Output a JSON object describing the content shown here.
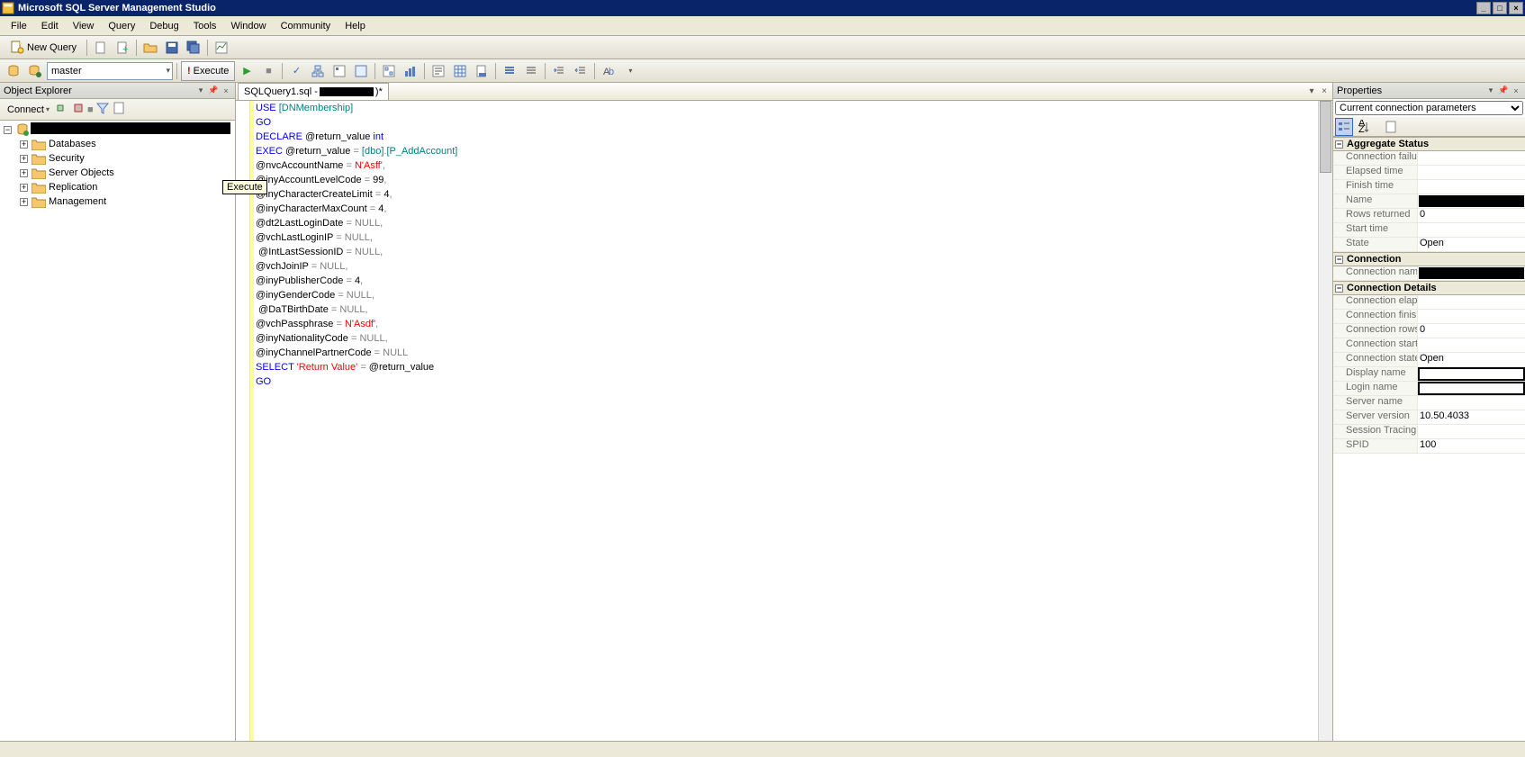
{
  "title": "Microsoft SQL Server Management Studio",
  "menu": [
    "File",
    "Edit",
    "View",
    "Query",
    "Debug",
    "Tools",
    "Window",
    "Community",
    "Help"
  ],
  "toolbar1": {
    "newquery": "New Query"
  },
  "toolbar2": {
    "database_combo": "master",
    "execute": "Execute",
    "tooltip": "Execute"
  },
  "object_explorer": {
    "title": "Object Explorer",
    "connect": "Connect",
    "nodes": [
      "Databases",
      "Security",
      "Server Objects",
      "Replication",
      "Management"
    ]
  },
  "editor": {
    "tab_prefix": "SQLQuery1.sql - ",
    "tab_suffix": ")*",
    "code_tokens": [
      [
        [
          "kw",
          "USE"
        ],
        [
          "var",
          " "
        ],
        [
          "sys",
          "[DNMembership]"
        ]
      ],
      [
        [
          "kw",
          "GO"
        ]
      ],
      [
        [
          "kw",
          "DECLARE"
        ],
        [
          "var",
          " @return_value "
        ],
        [
          "kw",
          "int"
        ]
      ],
      [
        [
          "kw",
          "EXEC"
        ],
        [
          "var",
          " @return_value "
        ],
        [
          "op",
          "="
        ],
        [
          "var",
          " "
        ],
        [
          "sys",
          "[dbo]"
        ],
        [
          "op",
          "."
        ],
        [
          "sys",
          "[P_AddAccount]"
        ]
      ],
      [
        [
          "var",
          "@nvcAccountName "
        ],
        [
          "op",
          "="
        ],
        [
          "var",
          " "
        ],
        [
          "str",
          "N'Asff'"
        ],
        [
          "op",
          ","
        ]
      ],
      [
        [
          "var",
          "@inyAccountLevelCode "
        ],
        [
          "op",
          "="
        ],
        [
          "var",
          " 99"
        ],
        [
          "op",
          ","
        ]
      ],
      [
        [
          "var",
          "@inyCharacterCreateLimit "
        ],
        [
          "op",
          "="
        ],
        [
          "var",
          " 4"
        ],
        [
          "op",
          ","
        ]
      ],
      [
        [
          "var",
          "@inyCharacterMaxCount "
        ],
        [
          "op",
          "="
        ],
        [
          "var",
          " 4"
        ],
        [
          "op",
          ","
        ]
      ],
      [
        [
          "var",
          "@dt2LastLoginDate "
        ],
        [
          "op",
          "="
        ],
        [
          "var",
          " "
        ],
        [
          "tok-gray",
          "NULL"
        ],
        [
          "op",
          ","
        ]
      ],
      [
        [
          "var",
          "@vchLastLoginIP "
        ],
        [
          "op",
          "="
        ],
        [
          "var",
          " "
        ],
        [
          "tok-gray",
          "NULL"
        ],
        [
          "op",
          ","
        ]
      ],
      [
        [
          "var",
          " @IntLastSessionID "
        ],
        [
          "op",
          "="
        ],
        [
          "var",
          " "
        ],
        [
          "tok-gray",
          "NULL"
        ],
        [
          "op",
          ","
        ]
      ],
      [
        [
          "var",
          "@vchJoinIP "
        ],
        [
          "op",
          "="
        ],
        [
          "var",
          " "
        ],
        [
          "tok-gray",
          "NULL"
        ],
        [
          "op",
          ","
        ]
      ],
      [
        [
          "var",
          "@inyPublisherCode "
        ],
        [
          "op",
          "="
        ],
        [
          "var",
          " 4"
        ],
        [
          "op",
          ","
        ]
      ],
      [
        [
          "var",
          "@inyGenderCode "
        ],
        [
          "op",
          "="
        ],
        [
          "var",
          " "
        ],
        [
          "tok-gray",
          "NULL"
        ],
        [
          "op",
          ","
        ]
      ],
      [
        [
          "var",
          " @DaTBirthDate "
        ],
        [
          "op",
          "="
        ],
        [
          "var",
          " "
        ],
        [
          "tok-gray",
          "NULL"
        ],
        [
          "op",
          ","
        ]
      ],
      [
        [
          "var",
          "@vchPassphrase "
        ],
        [
          "op",
          "="
        ],
        [
          "var",
          " "
        ],
        [
          "str",
          "N'Asdf'"
        ],
        [
          "op",
          ","
        ]
      ],
      [
        [
          "var",
          "@inyNationalityCode "
        ],
        [
          "op",
          "="
        ],
        [
          "var",
          " "
        ],
        [
          "tok-gray",
          "NULL"
        ],
        [
          "op",
          ","
        ]
      ],
      [
        [
          "var",
          "@inyChannelPartnerCode "
        ],
        [
          "op",
          "="
        ],
        [
          "var",
          " "
        ],
        [
          "tok-gray",
          "NULL"
        ]
      ],
      [
        [
          "kw",
          "SELECT"
        ],
        [
          "var",
          " "
        ],
        [
          "str",
          "'Return Value'"
        ],
        [
          "var",
          " "
        ],
        [
          "op",
          "="
        ],
        [
          "var",
          " @return_value"
        ]
      ],
      [
        [
          "kw",
          "GO"
        ]
      ]
    ]
  },
  "properties": {
    "title": "Properties",
    "combo": "Current connection parameters",
    "categories": [
      {
        "name": "Aggregate Status",
        "rows": [
          {
            "label": "Connection failures",
            "value": ""
          },
          {
            "label": "Elapsed time",
            "value": ""
          },
          {
            "label": "Finish time",
            "value": ""
          },
          {
            "label": "Name",
            "value": "",
            "redact": true
          },
          {
            "label": "Rows returned",
            "value": "0"
          },
          {
            "label": "Start time",
            "value": ""
          },
          {
            "label": "State",
            "value": "Open"
          }
        ]
      },
      {
        "name": "Connection",
        "rows": [
          {
            "label": "Connection name",
            "value": "",
            "redact": true
          }
        ]
      },
      {
        "name": "Connection Details",
        "rows": [
          {
            "label": "Connection elapsed",
            "value": ""
          },
          {
            "label": "Connection finish tim",
            "value": ""
          },
          {
            "label": "Connection rows re",
            "value": "0"
          },
          {
            "label": "Connection start tim",
            "value": ""
          },
          {
            "label": "Connection state",
            "value": "Open"
          },
          {
            "label": "Display name",
            "value": "",
            "redactbox": true
          },
          {
            "label": "Login name",
            "value": "",
            "redactbox": true
          },
          {
            "label": "Server name",
            "value": ""
          },
          {
            "label": "Server version",
            "value": "10.50.4033"
          },
          {
            "label": "Session Tracing ID",
            "value": ""
          },
          {
            "label": "SPID",
            "value": "100"
          }
        ]
      }
    ]
  }
}
